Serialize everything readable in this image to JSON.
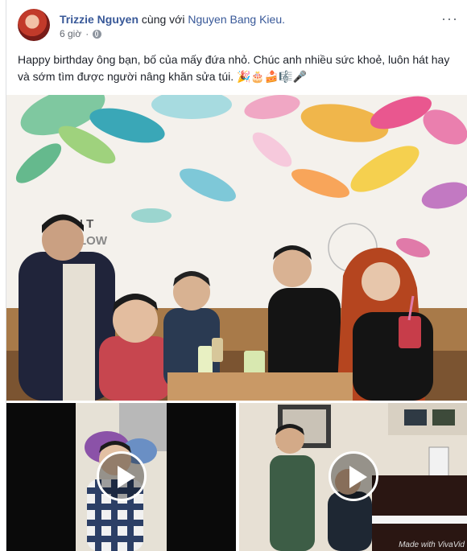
{
  "post": {
    "author": "Trizzie Nguyen",
    "with_text": "cùng với",
    "tagged": "Nguyen Bang Kieu.",
    "time": "6 giờ",
    "more_label": "···",
    "text": "Happy birthday ông bạn, bố của mấy đứa nhỏ. Chúc anh nhiều sức khoẻ, luôn hát hay và sớm tìm được người nâng khăn sửa túi. 🎉🎂🍰🎼🎤"
  },
  "media": {
    "photo_sign_text": "JOIN T FOLLOW",
    "video2_watermark": "Made with VivaVid"
  },
  "colors": {
    "link": "#385898",
    "text": "#1d2129",
    "meta": "#616770"
  }
}
